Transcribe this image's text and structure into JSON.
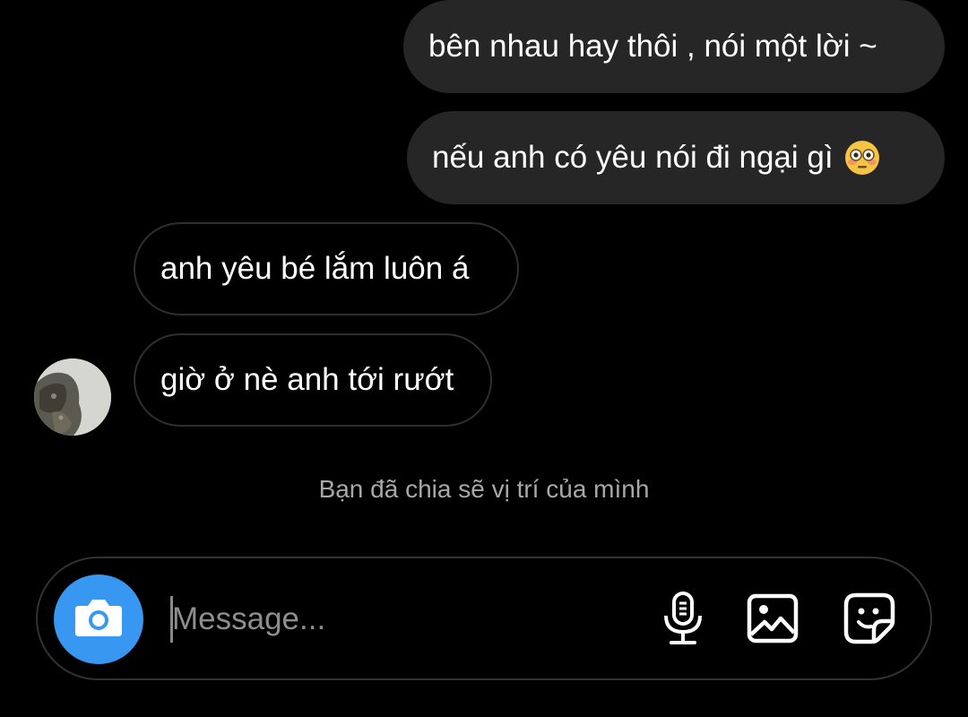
{
  "messages": [
    {
      "text": "bên nhau hay thôi , nói một lời ~",
      "direction": "outgoing"
    },
    {
      "text": "nếu anh có yêu nói đi ngại gì",
      "direction": "outgoing",
      "emoji": "flushed-face"
    },
    {
      "text": "anh yêu bé lắm luôn á",
      "direction": "incoming"
    },
    {
      "text": "giờ ở nè anh tới rướt",
      "direction": "incoming"
    }
  ],
  "system_note": "Bạn đã chia sẽ vị trí của mình",
  "composer": {
    "placeholder": "Message...",
    "value": "",
    "camera_icon": "camera-icon",
    "mic_icon": "microphone-icon",
    "gallery_icon": "image-icon",
    "sticker_icon": "sticker-icon"
  },
  "colors": {
    "background": "#000000",
    "outgoing_bubble": "#262626",
    "incoming_border": "#2f2f2f",
    "accent": "#3897f0",
    "muted_text": "#a8a8a8"
  }
}
